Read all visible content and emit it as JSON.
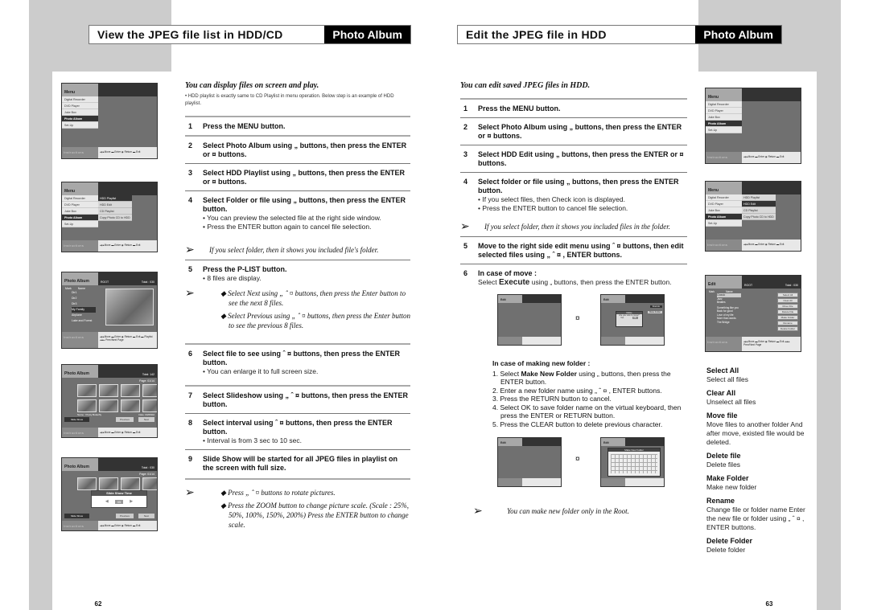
{
  "left_page": {
    "header": {
      "title": "View the JPEG file list in HDD/CD",
      "badge": "Photo Album"
    },
    "intro": {
      "title": "You can display files on screen and play.",
      "note": "• HDD playlist is exactly same to CD Playlist in menu operation. Below step is an example of HDD playlist."
    },
    "steps": [
      {
        "num": "1",
        "main": "Press the MENU button.",
        "subs": []
      },
      {
        "num": "2",
        "main": "Select Photo Album using „      buttons, then press the ENTER or ¤ buttons.",
        "subs": []
      },
      {
        "num": "3",
        "main": "Select HDD Playlist using „      buttons, then press the ENTER or ¤ buttons.",
        "subs": []
      },
      {
        "num": "4",
        "main": "Select Folder or file using „      buttons, then press the ENTER button.",
        "subs": [
          "• You can preview the selected file at the right side window.",
          "• Press the ENTER button again to cancel file selection."
        ]
      }
    ],
    "note_folder": "If you select folder, then it shows you included file's folder.",
    "step5": {
      "num": "5",
      "main": "Press the P-LIST button.",
      "sub": "• 8 files are display."
    },
    "note_next_prev": [
      "◆ Select Next using „    ˆ ¤  buttons, then press the Enter button to see the next 8 files.",
      "◆ Select Previous using „    ˆ ¤  buttons, then press the Enter button to see the previous 8 files."
    ],
    "steps_b": [
      {
        "num": "6",
        "main": "Select file to see using ˆ ¤ buttons, then press the ENTER button.",
        "sub": "• You can enlarge it to full screen size."
      },
      {
        "num": "7",
        "main": "Select Slideshow using „   ˆ ¤ buttons, then press the ENTER button.",
        "sub": ""
      },
      {
        "num": "8",
        "main": "Select interval using ˆ ¤  buttons, then press the ENTER button.",
        "sub": "• Interval is from 3 sec to 10 sec."
      },
      {
        "num": "9",
        "main": "Slide Show will be started for all JPEG files in playlist on the screen with full size.",
        "sub": ""
      }
    ],
    "note_rotate": [
      "◆ Press „   ˆ ¤  buttons to rotate pictures.",
      "◆ Press the ZOOM button to change picture scale. (Scale : 25%, 50%, 100%, 150%, 200%) Press the ENTER button to change scale."
    ],
    "page_number": "62",
    "screens": {
      "menu1": {
        "title": "Menu",
        "items": [
          "Digital Recorder",
          "DVD Player",
          "Juke Box",
          "Photo Album",
          "Set-Up"
        ],
        "selected": "Photo Album",
        "footer_label": "Instructions",
        "footer_help": "◂◈▸Move  ▬ Enter  ◉ Return  ▬ Exit"
      },
      "menu2": {
        "title": "Menu",
        "items": [
          "Digital Recorder",
          "DVD Player",
          "Juke Box",
          "Photo Album",
          "Set-Up"
        ],
        "sub_items": [
          "HDD Playlist",
          "HDD Edit",
          "CD Playlist",
          "Copy Photo CD to HDD"
        ],
        "selected_sub": "HDD Playlist",
        "footer_label": "Instructions",
        "footer_help": "◂◈▸Move  ▬ Enter  ◉ Return  ▬ Exit"
      },
      "album_list": {
        "title": "Photo Album",
        "folder": "ROOT",
        "total": "Total : 030",
        "col_mark": "Mark",
        "col_name": "Name",
        "folders": [
          "Dir1",
          "Dir2",
          "Dir3"
        ],
        "files": [
          "My Family",
          "Airplane",
          "Lake and Forest"
        ],
        "footer_label": "Instructions",
        "footer_help": "◂◈▸Move  ▬ Enter  ◉ Return  ▬ Exit  ▬ Playlist  ◂◂▸▸ Prev/Next Page"
      },
      "album_thumbs": {
        "title": "Photo Album",
        "total": "Total: 142",
        "page": "Page: 01/14",
        "name": "Name : Pretty Butterfly",
        "date": "Date: 03/05/02",
        "btn_slideshow": "Slide Show",
        "btn_previous": "Previous",
        "btn_next": "Next",
        "footer_label": "Instructions",
        "footer_help": "◂◈▸Move  ▬ Enter  ◉ Return  ▬ Exit"
      },
      "slideshow_time": {
        "title": "Photo Album",
        "total": "Total : 030",
        "page": "Page: 01/14",
        "dialog_title": "Slide Show Time",
        "value": "05",
        "btn_slideshow": "Slide Show",
        "btn_previous": "Previous",
        "btn_next": "Next",
        "footer_label": "Instructions",
        "footer_help": "◂◈▸Move  ▬ Enter  ◉ Return  ▬ Exit"
      }
    }
  },
  "right_page": {
    "header": {
      "title": "Edit the JPEG file in HDD",
      "badge": "Photo Album"
    },
    "intro": {
      "title": "You can edit saved JPEG files in HDD."
    },
    "steps": [
      {
        "num": "1",
        "main": "Press the MENU button.",
        "subs": []
      },
      {
        "num": "2",
        "main": "Select Photo Album using „      buttons, then press the ENTER or ¤ buttons.",
        "subs": []
      },
      {
        "num": "3",
        "main": "Select HDD Edit using „      buttons, then press the ENTER or ¤ buttons.",
        "subs": []
      },
      {
        "num": "4",
        "main": "Select folder or file using „      buttons, then press  the ENTER button.",
        "subs": [
          "• If you select files, then Check icon is displayed.",
          "• Press the ENTER button to cancel file selection."
        ]
      }
    ],
    "note_folder": "If you select folder, then it shows you included files in the folder.",
    "step5": {
      "num": "5",
      "main": "Move to the right side edit menu using ˆ ¤ buttons, then edit selected files using „    ˆ ¤ , ENTER buttons."
    },
    "step6": {
      "num": "6",
      "main": "In case of move :",
      "sub_prefix": "Select ",
      "sub_bold": "Execute",
      "sub_suffix": " using „      buttons, then press the ENTER button."
    },
    "new_folder": {
      "heading": "In case of making new folder :",
      "items": [
        {
          "prefix": "1.  Select ",
          "bold": "Make New Folder",
          "suffix": " using „      buttons, then press the ENTER button."
        },
        {
          "prefix": "2.  Enter a new folder name using „    ˆ ¤ , ENTER buttons.",
          "bold": "",
          "suffix": ""
        },
        {
          "prefix": "3.  Press the RETURN button to cancel.",
          "bold": "",
          "suffix": ""
        },
        {
          "prefix": "4.  Select OK to save folder name on the virtual keyboard, then press the ENTER or RETURN button.",
          "bold": "",
          "suffix": ""
        },
        {
          "prefix": "5.  Press the CLEAR button to delete previous character.",
          "bold": "",
          "suffix": ""
        }
      ]
    },
    "note_root": "You can make new folder only in the Root.",
    "arrow_glyph": "¤",
    "side_terms": [
      {
        "term": "Select All",
        "def": "Select all files"
      },
      {
        "term": "Clear All",
        "def": "Unselect all files"
      },
      {
        "term": "Move file",
        "def": "Move files to another folder And after move, existed file would be deleted."
      },
      {
        "term": "Delete file",
        "def": "Delete files"
      },
      {
        "term": "Make Folder",
        "def": "Make new folder"
      },
      {
        "term": "Rename",
        "def": "Change file or folder name Enter the new file or folder using „    ˆ ¤ , ENTER buttons."
      },
      {
        "term": "Delete Folder",
        "def": "Delete folder"
      }
    ],
    "page_number": "63",
    "screens": {
      "menu1": {
        "title": "Menu",
        "items": [
          "Digital Recorder",
          "DVD Player",
          "Juke Box",
          "Photo Album",
          "Set-Up"
        ],
        "footer_label": "Instructions",
        "footer_help": "◂◈▸Move  ▬ Enter  ◉ Return  ▬ Exit"
      },
      "menu2": {
        "title": "Menu",
        "items": [
          "Digital Recorder",
          "DVD Player",
          "Juke Box",
          "Photo Album",
          "Set-Up"
        ],
        "sub_items": [
          "HDD Playlist",
          "HDD Edit",
          "CD Playlist",
          "Copy Photo CD to HDD"
        ],
        "selected_sub": "HDD Edit",
        "footer_label": "Instructions",
        "footer_help": "◂◈▸Move  ▬ Enter  ◉ Return  ▬ Exit"
      },
      "edit": {
        "title": "Edit",
        "folder": "ROOT",
        "total": "Total : 030",
        "col_mark": "Mark",
        "col_name": "Name",
        "folders": [
          "Classic",
          "Jazz",
          "Beatles"
        ],
        "files": [
          "Something like you",
          "Back for good",
          "Love of my life",
          "More than words",
          "The Bridge"
        ],
        "buttons": [
          "Select All",
          "Clear All",
          "Move File",
          "Delete File",
          "Make Folder",
          "Rename",
          "Delete Folder"
        ],
        "footer_label": "Instructions",
        "footer_help": "◂◈▸Move  ▬ Enter  ◉ Return  ▬ Exit  ◂◂▸▸ Prev/Next Page"
      },
      "move_confirm": {
        "dialog_title": "Notice",
        "dialog_text": "Are you sure to move?",
        "yes": "Yes",
        "no": "No",
        "execute": "Execute",
        "make_folder": "Make Folder"
      },
      "new_folder_kb": {
        "dialog_title": "Make New Folder"
      }
    }
  }
}
